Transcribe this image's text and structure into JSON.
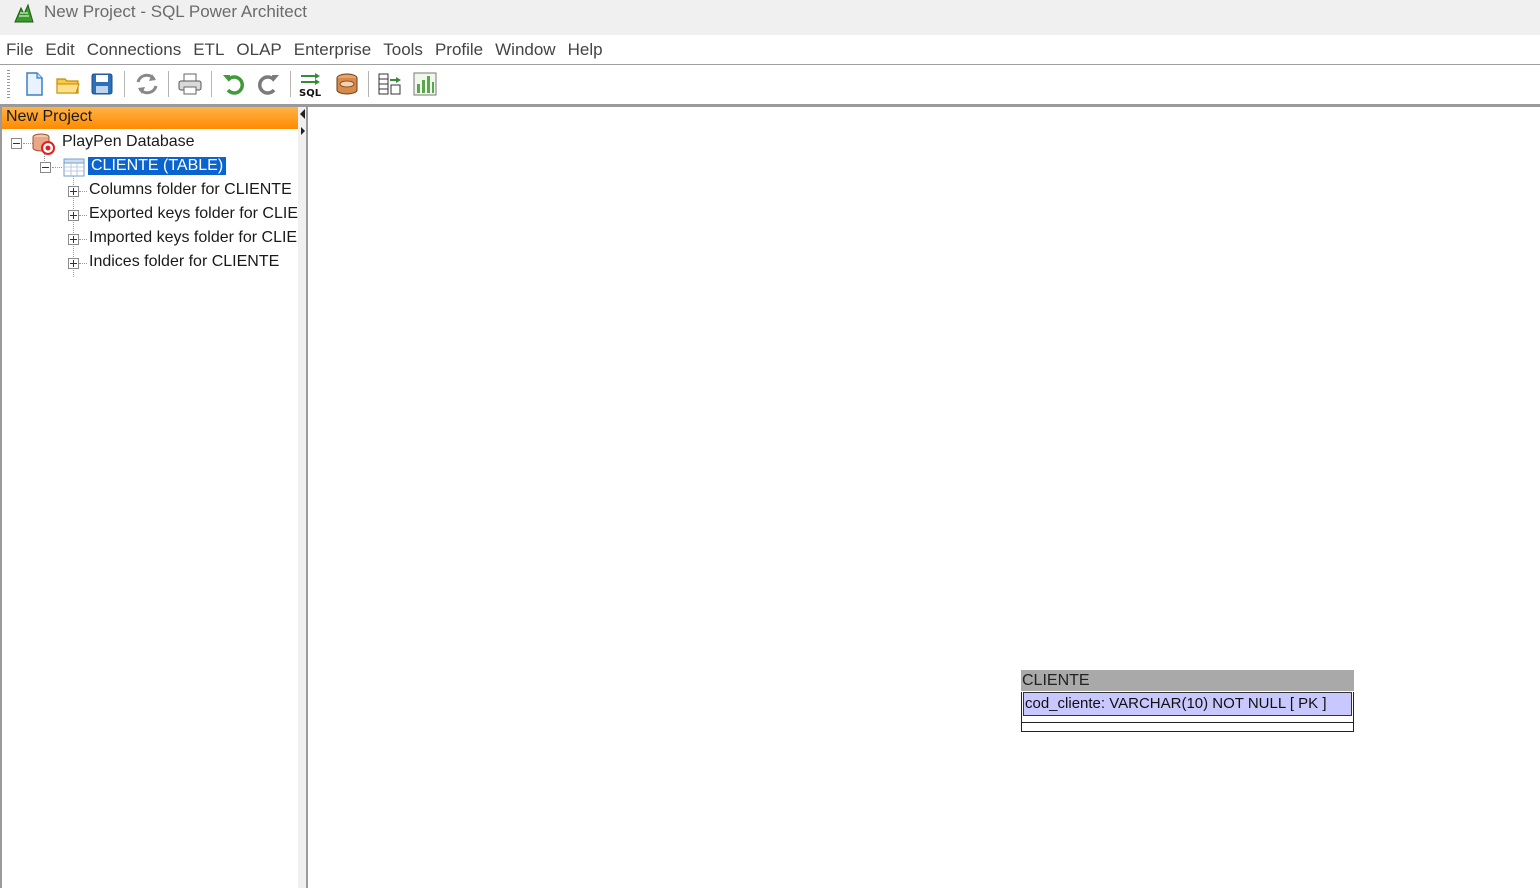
{
  "window": {
    "title": "New Project - SQL Power Architect"
  },
  "menu": [
    "File",
    "Edit",
    "Connections",
    "ETL",
    "OLAP",
    "Enterprise",
    "Tools",
    "Profile",
    "Window",
    "Help"
  ],
  "toolbar": {
    "buttons": [
      {
        "name": "new-project-button",
        "icon": "new-document-icon"
      },
      {
        "name": "open-project-button",
        "icon": "folder-open-icon"
      },
      {
        "name": "save-project-button",
        "icon": "save-icon"
      },
      {
        "name": "compare-dm-button",
        "icon": "refresh-arrows-icon"
      },
      {
        "name": "print-button",
        "icon": "printer-icon"
      },
      {
        "name": "undo-button",
        "icon": "undo-icon"
      },
      {
        "name": "redo-button",
        "icon": "redo-icon"
      },
      {
        "name": "forward-engineer-button",
        "icon": "sql-icon"
      },
      {
        "name": "compare-database-button",
        "icon": "database-icon"
      },
      {
        "name": "data-mover-button",
        "icon": "data-mover-icon"
      },
      {
        "name": "profile-button",
        "icon": "bar-chart-icon"
      }
    ]
  },
  "left_panel": {
    "title": "New Project",
    "tree": {
      "root": "PlayPen Database",
      "table": "CLIENTE (TABLE)",
      "folders": [
        "Columns folder for CLIENTE",
        "Exported keys folder for CLIENTE",
        "Imported keys folder for CLIENTE",
        "Indices folder for CLIENTE"
      ]
    }
  },
  "playpen": {
    "table": {
      "name": "CLIENTE",
      "columns": [
        "cod_cliente: VARCHAR(10)   NOT NULL  [ PK ]"
      ]
    }
  },
  "colors": {
    "panel_header": "#ff8a00",
    "selection": "#0a64d0",
    "table_header": "#a9a9a9",
    "column_highlight": "#c8c8ff"
  }
}
